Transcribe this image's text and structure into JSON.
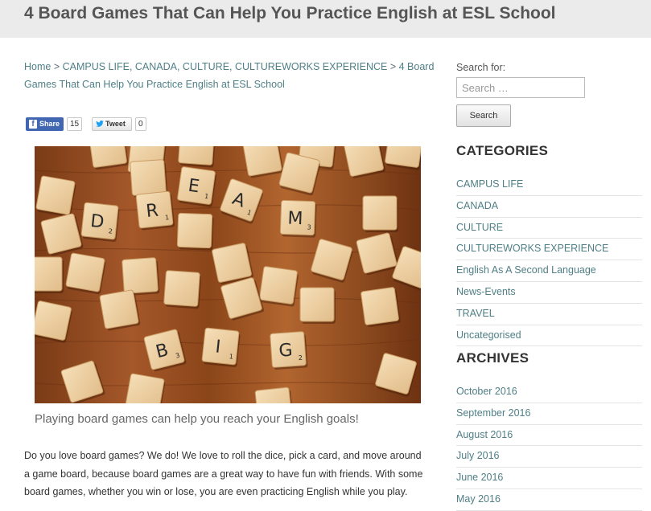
{
  "page": {
    "title": "4 Board Games That Can Help You Practice English at ESL School"
  },
  "breadcrumb": {
    "home": "Home",
    "sep1": " > ",
    "categories": "CAMPUS LIFE, CANADA, CULTURE, CULTUREWORKS EXPERIENCE",
    "sep2": " > ",
    "current": "4 Board Games That Can Help You Practice English at ESL School"
  },
  "share": {
    "facebook_label": "Share",
    "facebook_icon": "facebook-f-icon",
    "facebook_count": "15",
    "twitter_label": "Tweet",
    "twitter_icon": "twitter-bird-icon",
    "twitter_count": "0"
  },
  "article": {
    "image_letters": [
      "D",
      "R",
      "E",
      "A",
      "M",
      "B",
      "I",
      "G"
    ],
    "caption": "Playing board games can help you reach your English goals!",
    "paragraph": "Do you love board games? We do! We love to roll the dice, pick a card, and move around a game board, because board games are a great way to have fun with friends. With some board games, whether you win or lose, you are even practicing English while you play."
  },
  "sidebar": {
    "search": {
      "label": "Search for:",
      "placeholder": "Search …",
      "button": "Search"
    },
    "categories": {
      "heading": "CATEGORIES",
      "items": [
        "CAMPUS LIFE",
        "CANADA",
        "CULTURE",
        "CULTUREWORKS EXPERIENCE",
        "English As A Second Language",
        "News-Events",
        "TRAVEL",
        "Uncategorised"
      ]
    },
    "archives": {
      "heading": "ARCHIVES",
      "items": [
        "October 2016",
        "September 2016",
        "August 2016",
        "July 2016",
        "June 2016",
        "May 2016"
      ]
    }
  },
  "colors": {
    "link": "#4f7f86",
    "facebook": "#4267b2",
    "title_bar": "#ebebeb"
  }
}
